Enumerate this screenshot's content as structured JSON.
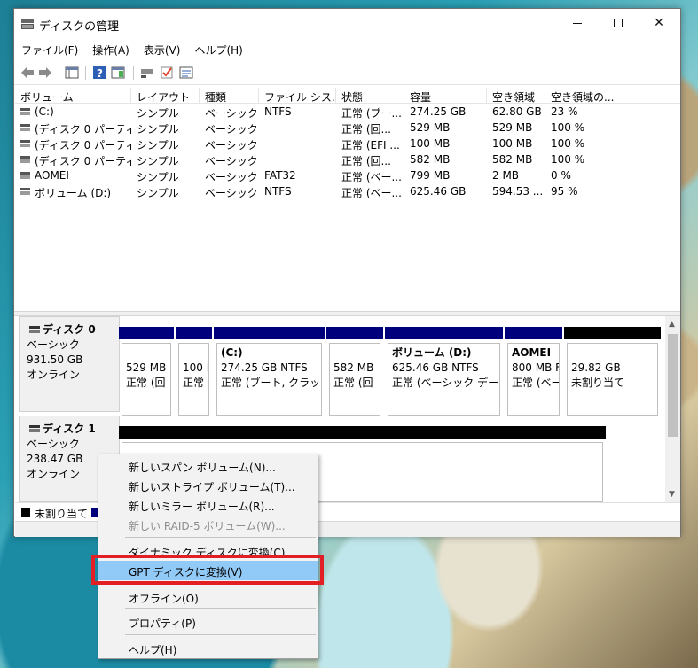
{
  "window": {
    "title": "ディスクの管理"
  },
  "menu": [
    "ファイル(F)",
    "操作(A)",
    "表示(V)",
    "ヘルプ(H)"
  ],
  "toolbar": {
    "icons": [
      "back-arrow-icon",
      "forward-arrow-icon",
      "console-tree-icon",
      "help-icon",
      "action-pane-icon",
      "connect-icon",
      "check-icon",
      "properties-icon"
    ]
  },
  "volumes": {
    "columns": [
      "ボリューム",
      "レイアウト",
      "種類",
      "ファイル シス...",
      "状態",
      "容量",
      "空き領域",
      "空き領域の..."
    ],
    "rows": [
      [
        "(C:)",
        "シンプル",
        "ベーシック",
        "NTFS",
        "正常 (ブー...",
        "274.25 GB",
        "62.80 GB",
        "23 %"
      ],
      [
        "(ディスク 0 パーティ...",
        "シンプル",
        "ベーシック",
        "",
        "正常 (回...",
        "529 MB",
        "529 MB",
        "100 %"
      ],
      [
        "(ディスク 0 パーティ...",
        "シンプル",
        "ベーシック",
        "",
        "正常 (EFI ...",
        "100 MB",
        "100 MB",
        "100 %"
      ],
      [
        "(ディスク 0 パーティ...",
        "シンプル",
        "ベーシック",
        "",
        "正常 (回...",
        "582 MB",
        "582 MB",
        "100 %"
      ],
      [
        "AOMEI",
        "シンプル",
        "ベーシック",
        "FAT32",
        "正常 (ベー...",
        "799 MB",
        "2 MB",
        "0 %"
      ],
      [
        "ボリューム (D:)",
        "シンプル",
        "ベーシック",
        "NTFS",
        "正常 (ベー...",
        "625.46 GB",
        "594.53 ...",
        "95 %"
      ]
    ]
  },
  "disks": [
    {
      "name": "ディスク 0",
      "type": "ベーシック",
      "size": "931.50 GB",
      "status": "オンライン",
      "partitions": [
        {
          "title": "",
          "line1": "529 MB",
          "line2": "正常 (回"
        },
        {
          "title": "",
          "line1": "100 M",
          "line2": "正常"
        },
        {
          "title": "(C:)",
          "line1": "274.25 GB NTFS",
          "line2": "正常 (ブート, クラッシュ"
        },
        {
          "title": "",
          "line1": "582 MB",
          "line2": "正常 (回"
        },
        {
          "title": "ボリューム (D:)",
          "line1": "625.46 GB NTFS",
          "line2": "正常 (ベーシック データ"
        },
        {
          "title": "AOMEI",
          "line1": "800 MB F",
          "line2": "正常 (ベー"
        },
        {
          "title": "",
          "line1": "29.82 GB",
          "line2": "未割り当て"
        }
      ]
    },
    {
      "name": "ディスク 1",
      "type": "ベーシック",
      "size": "238.47 GB",
      "status": "オンライン"
    }
  ],
  "legend": {
    "unallocated": "未割り当て",
    "colors": {
      "unallocated": "#000000",
      "primary": "#00007c"
    }
  },
  "context_menu": {
    "items": [
      {
        "label": "新しいスパン ボリューム(N)...",
        "disabled": false
      },
      {
        "label": "新しいストライプ ボリューム(T)...",
        "disabled": false
      },
      {
        "label": "新しいミラー ボリューム(R)...",
        "disabled": false
      },
      {
        "label": "新しい RAID-5 ボリューム(W)...",
        "disabled": true
      },
      {
        "label": "ダイナミック ディスクに変換(C)...",
        "disabled": false
      },
      {
        "label": "GPT ディスクに変換(V)",
        "disabled": false,
        "selected": true
      },
      {
        "label": "オフライン(O)",
        "disabled": false
      },
      {
        "label": "プロパティ(P)",
        "disabled": false
      },
      {
        "label": "ヘルプ(H)",
        "disabled": false
      }
    ],
    "highlight_color": "#e31f26"
  }
}
